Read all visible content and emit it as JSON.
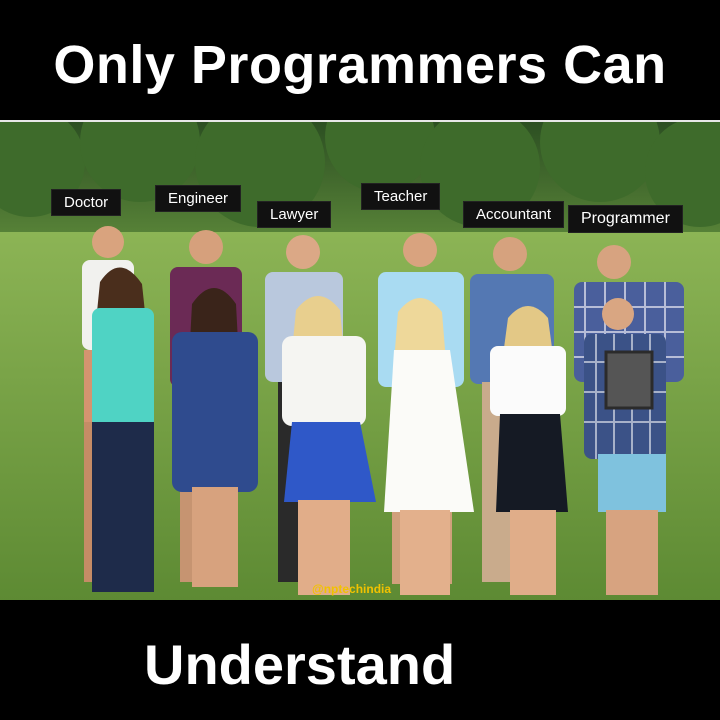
{
  "header": {
    "title": "Only Programmers Can"
  },
  "footer": {
    "text": "Understand"
  },
  "labels": [
    "Doctor",
    "Engineer",
    "Lawyer",
    "Teacher",
    "Accountant",
    "Programmer"
  ],
  "watermark": "@nptechindia",
  "colors": {
    "background": "#000000",
    "text": "#ffffff",
    "watermark": "#f2c200",
    "grass": "#6f9a3e",
    "trees": "#2f5a25"
  }
}
